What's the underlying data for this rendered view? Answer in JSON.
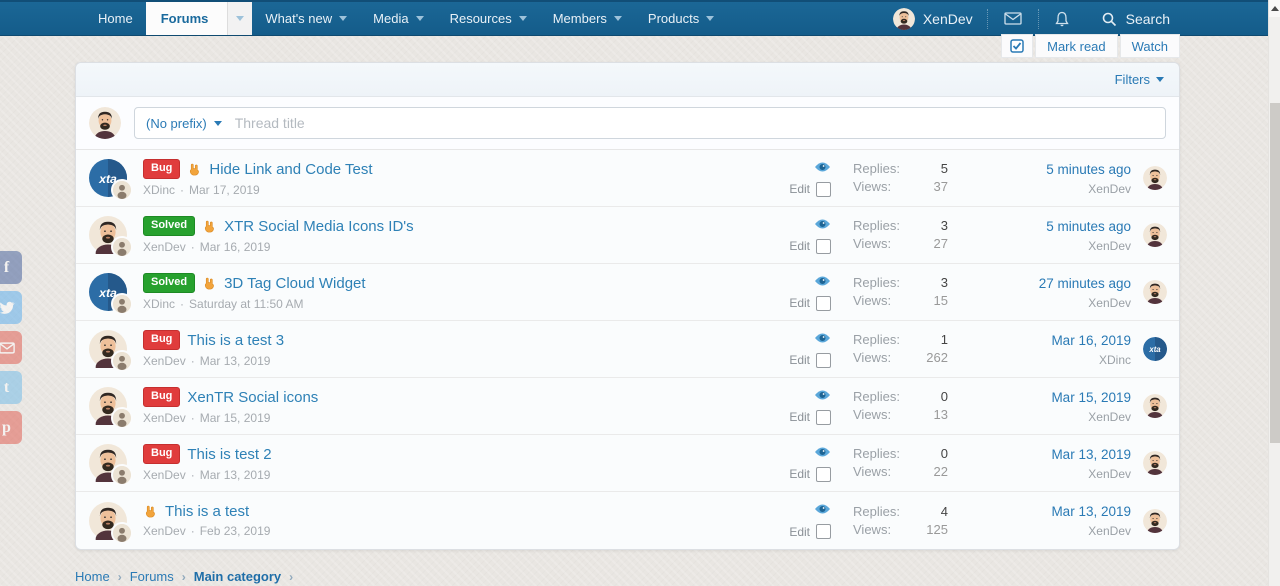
{
  "nav": {
    "items": [
      {
        "label": "Home",
        "arrow": false
      },
      {
        "label": "Forums",
        "arrow": true,
        "active": true
      },
      {
        "label": "What's new",
        "arrow": true
      },
      {
        "label": "Media",
        "arrow": true
      },
      {
        "label": "Resources",
        "arrow": true
      },
      {
        "label": "Members",
        "arrow": true
      },
      {
        "label": "Products",
        "arrow": true
      }
    ],
    "user_name": "XenDev",
    "search_label": "Search"
  },
  "toolbar": {
    "mark_read_label": "Mark read",
    "watch_label": "Watch"
  },
  "list_header": {
    "filters_label": "Filters"
  },
  "composer": {
    "prefix_label": "(No prefix)",
    "title_placeholder": "Thread title"
  },
  "row_labels": {
    "edit": "Edit",
    "replies": "Replies:",
    "views": "Views:",
    "sep": "·"
  },
  "avatars": {
    "xdinc_text": "xta"
  },
  "threads": [
    {
      "prefix": "Bug",
      "prefix_type": "bug",
      "emoji": true,
      "title": "Hide Link and Code Test",
      "author": "XDinc",
      "date": "Mar 17, 2019",
      "starter_avatar": "xdinc",
      "replies": "5",
      "views": "37",
      "last_date": "5 minutes ago",
      "last_user": "XenDev",
      "last_avatar": "xendev"
    },
    {
      "prefix": "Solved",
      "prefix_type": "solved",
      "emoji": true,
      "title": "XTR Social Media Icons ID's",
      "author": "XenDev",
      "date": "Mar 16, 2019",
      "starter_avatar": "xendev",
      "replies": "3",
      "views": "27",
      "last_date": "5 minutes ago",
      "last_user": "XenDev",
      "last_avatar": "xendev"
    },
    {
      "prefix": "Solved",
      "prefix_type": "solved",
      "emoji": true,
      "title": "3D Tag Cloud Widget",
      "author": "XDinc",
      "date": "Saturday at 11:50 AM",
      "starter_avatar": "xdinc",
      "replies": "3",
      "views": "15",
      "last_date": "27 minutes ago",
      "last_user": "XenDev",
      "last_avatar": "xendev"
    },
    {
      "prefix": "Bug",
      "prefix_type": "bug",
      "emoji": false,
      "title": "This is a test 3",
      "author": "XenDev",
      "date": "Mar 13, 2019",
      "starter_avatar": "xendev",
      "replies": "1",
      "views": "262",
      "last_date": "Mar 16, 2019",
      "last_user": "XDinc",
      "last_avatar": "xdinc"
    },
    {
      "prefix": "Bug",
      "prefix_type": "bug",
      "emoji": false,
      "title": "XenTR Social icons",
      "author": "XenDev",
      "date": "Mar 15, 2019",
      "starter_avatar": "xendev",
      "replies": "0",
      "views": "13",
      "last_date": "Mar 15, 2019",
      "last_user": "XenDev",
      "last_avatar": "xendev"
    },
    {
      "prefix": "Bug",
      "prefix_type": "bug",
      "emoji": false,
      "title": "This is test 2",
      "author": "XenDev",
      "date": "Mar 13, 2019",
      "starter_avatar": "xendev",
      "replies": "0",
      "views": "22",
      "last_date": "Mar 13, 2019",
      "last_user": "XenDev",
      "last_avatar": "xendev"
    },
    {
      "prefix": "",
      "prefix_type": "",
      "emoji": true,
      "title": "This is a test",
      "author": "XenDev",
      "date": "Feb 23, 2019",
      "starter_avatar": "xendev",
      "replies": "4",
      "views": "125",
      "last_date": "Mar 13, 2019",
      "last_user": "XenDev",
      "last_avatar": "xendev"
    }
  ],
  "breadcrumb": {
    "items": [
      "Home",
      "Forums",
      "Main category"
    ],
    "sep": "›"
  },
  "share_bar": {
    "buttons": [
      "facebook",
      "twitter",
      "email",
      "tumblr",
      "pinterest"
    ]
  },
  "colors": {
    "navbar": "#17618f",
    "link": "#2a7ab5",
    "bug_badge": "#e03c3c",
    "solved_badge": "#27a12e"
  }
}
